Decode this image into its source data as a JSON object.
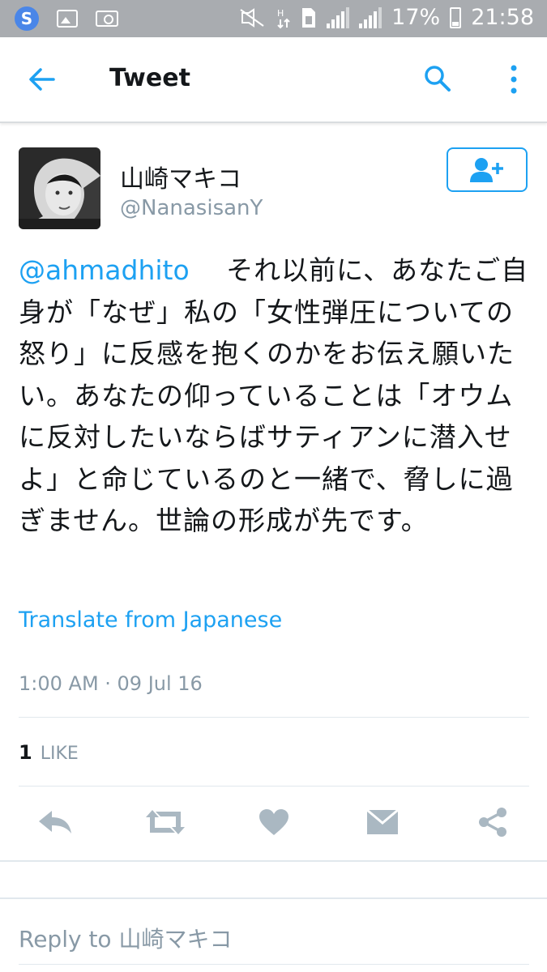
{
  "status_bar": {
    "battery": "17%",
    "time": "21:58",
    "icons": [
      "app-s-icon",
      "image-icon",
      "camera-icon",
      "mute-icon",
      "data-icon",
      "sim-icon",
      "signal-icon",
      "signal-icon",
      "battery-icon"
    ]
  },
  "header": {
    "title": "Tweet",
    "back_icon": "arrow-left-icon",
    "search_icon": "search-icon",
    "more_icon": "more-vert-icon"
  },
  "tweet": {
    "author_name": "山崎マキコ",
    "author_handle": "@NanasisanY",
    "mention": "@ahmadhito",
    "text": "それ以前に、あなたご自身が「なぜ」私の「女性弾圧についての怒り」に反感を抱くのかをお伝え願いたい。あなたの仰っていることは「オウムに反対したいならばサティアンに潜入せよ」と命じているのと一緒で、脅しに過ぎません。世論の形成が先です。",
    "translate": "Translate from Japanese",
    "timestamp": "1:00 AM · 09 Jul 16",
    "likes_count": "1",
    "likes_label": "LIKE"
  },
  "actions": [
    "reply-icon",
    "retweet-icon",
    "like-icon",
    "direct-message-icon",
    "share-icon"
  ],
  "reply": {
    "placeholder": "Reply to 山崎マキコ"
  },
  "colors": {
    "accent": "#1da1f2",
    "muted": "#8899a6",
    "icon_gray": "#aab8c2",
    "status_bar": "#a9acb0"
  }
}
